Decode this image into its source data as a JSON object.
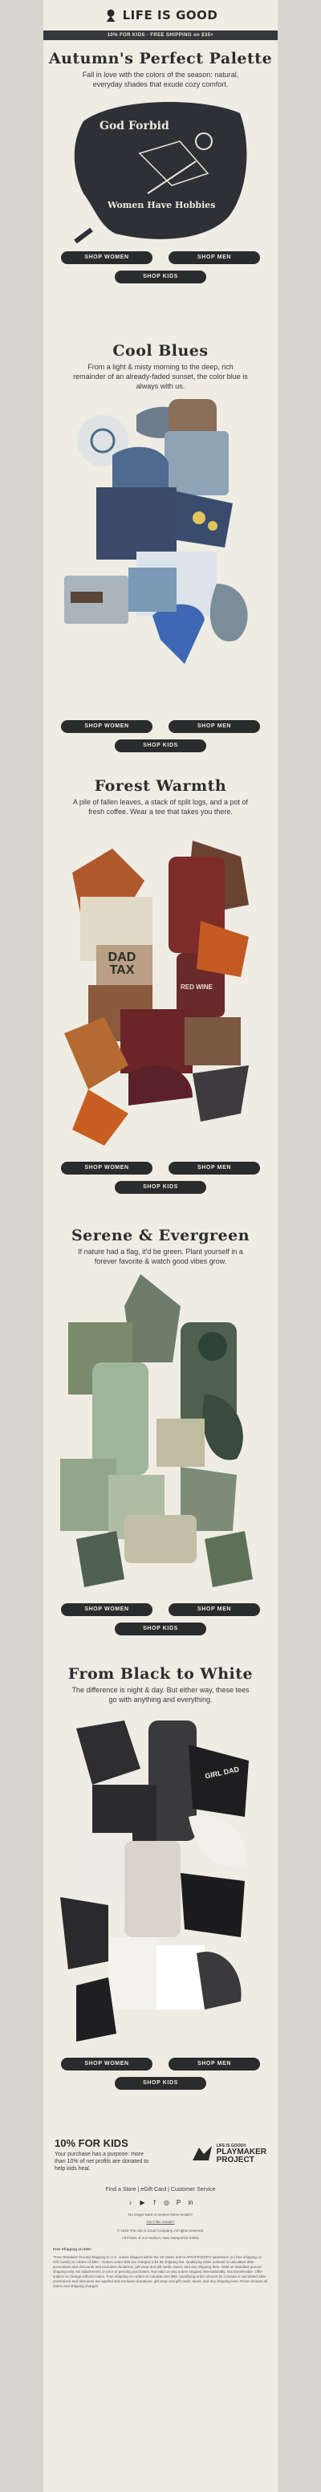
{
  "brand": {
    "logo_text": "LIFE IS GOOD",
    "registered": "®"
  },
  "promo": "10% FOR KIDS · FREE SHIPPING on $35+",
  "sections": [
    {
      "title": "Autumn's Perfect Palette",
      "subtitle": "Fall in love with the colors of the season: natural, everyday shades that exude cozy comfort.",
      "art_text_top": "God Forbid",
      "art_text_bottom": "Women Have Hobbies",
      "btn_women": "SHOP WOMEN",
      "btn_men": "SHOP MEN",
      "btn_kids": "SHOP KIDS"
    },
    {
      "title": "Cool Blues",
      "subtitle": "From a light & misty morning to the deep, rich remainder of an already-faded sunset, the color blue is always with us.",
      "btn_women": "SHOP WOMEN",
      "btn_men": "SHOP MEN",
      "btn_kids": "SHOP KIDS"
    },
    {
      "title": "Forest Warmth",
      "subtitle": "A pile of fallen leaves, a stack of split logs, and a pot of fresh coffee. Wear a tee that takes you there.",
      "art_text_1": "DAD TAX",
      "art_text_2": "RED WINE",
      "btn_women": "SHOP WOMEN",
      "btn_men": "SHOP MEN",
      "btn_kids": "SHOP KIDS"
    },
    {
      "title": "Serene & Evergreen",
      "subtitle": "If nature had a flag, it'd be green. Plant yourself in a forever favorite & watch good vibes grow.",
      "btn_women": "SHOP WOMEN",
      "btn_men": "SHOP MEN",
      "btn_kids": "SHOP KIDS"
    },
    {
      "title": "From Black to White",
      "subtitle": "The difference is night & day. But either way, these tees go with anything and everything.",
      "art_text_1": "GIRL DAD",
      "btn_women": "SHOP WOMEN",
      "btn_men": "SHOP MEN",
      "btn_kids": "SHOP KIDS"
    }
  ],
  "footer": {
    "kids_title": "10% FOR KIDS",
    "kids_text": "Your purchase has a purpose: more than 10% of net profits are donated to help kids heal.",
    "playmaker_top": "LIFE IS GOOD®",
    "playmaker_line1": "PLAYMAKER",
    "playmaker_line2": "PROJECT",
    "links": "Find a Store  |  eGift Card  |  Customer Service",
    "unsubscribe_q": "No longer want to receive these emails?",
    "unsubscribe": "Don't like emails?",
    "copyright": "© 2023 The Life is Good Company. All rights reserved.",
    "address": "All Points of our Hudson, New Hampshire 03051",
    "shipping_title": "Free Shipping on $35+",
    "shipping_text": "*Free Standard Ground Shipping to U.S. orders shipped within the 48 states and to APO/FPO/DPO addresses (no free shipping on Gift Cards) on orders of $35+. Orders under $35 are charged a $4.95 shipping fee. Qualifying order subtotal is calculated after promotions and discounts and excludes donations, gift wrap and gift cards, taxes, and any shipping fees. Valid on standard ground shipping only. No adjustments or prior or pending purchases. Not valid on any orders shipped internationally. Not transferable. Offer subject to change without notice. Free shipping on orders to Canada over $50. Qualifying order amount for Canada is calculated after promotions and discounts are applied and excludes donations, gift wrap and gift cards, taxes, and any shipping fees. Prices include all duties and shipping charges."
  },
  "colors": {
    "background": "#efece4",
    "dark": "#2a2b2d",
    "outer": "#d9d6cf"
  },
  "icons": [
    "life-is-good-logo-icon",
    "tiktok-icon",
    "youtube-icon",
    "facebook-icon",
    "instagram-icon",
    "pinterest-icon",
    "linkedin-icon",
    "playmaker-icon"
  ]
}
